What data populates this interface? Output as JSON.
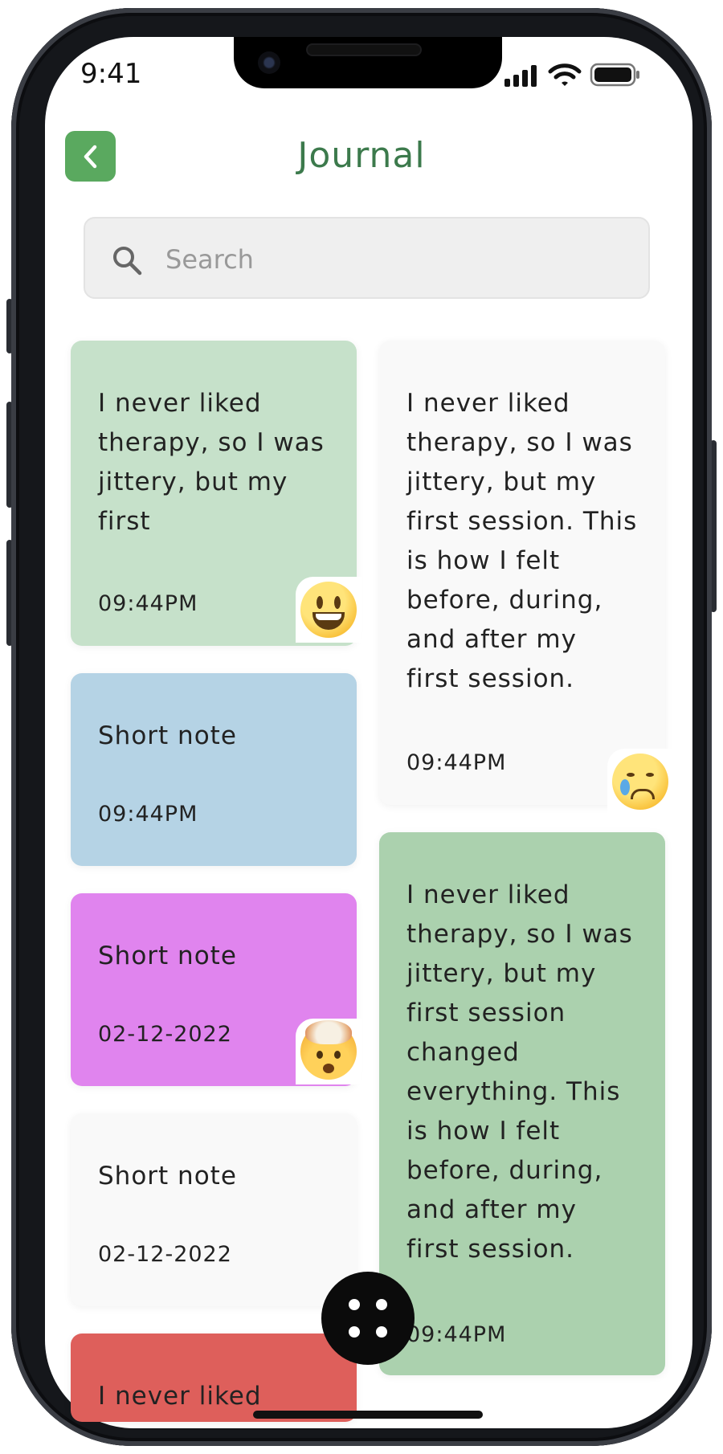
{
  "status_bar": {
    "time": "9:41"
  },
  "header": {
    "title": "Journal"
  },
  "search": {
    "placeholder": "Search"
  },
  "colors": {
    "green_light": "#c6e1ca",
    "blue": "#b5d3e5",
    "purple": "#e084ee",
    "white": "#f9f9f9",
    "red": "#de5f5b",
    "green_mid": "#abd1ae",
    "accent": "#5aa95f"
  },
  "notes": [
    {
      "text": "I never liked therapy, so I was jittery, but my first",
      "time": "09:44PM",
      "emoji": "smiling-face-emoji"
    },
    {
      "text": "Short note",
      "time": "09:44PM"
    },
    {
      "text": "Short note",
      "time": "02-12-2022",
      "emoji": "exploding-head-emoji"
    },
    {
      "text": "Short note",
      "time": "02-12-2022"
    },
    {
      "text": "I never liked",
      "time": ""
    },
    {
      "text": "I never liked therapy, so I was jittery, but my first session. This is how I felt before, during, and after my first session.",
      "time": "09:44PM",
      "emoji": "crying-face-emoji"
    },
    {
      "text": "I never liked therapy, so I was jittery, but my first session changed everything. This is how I felt before, during, and after my first session.",
      "time": "09:44PM"
    }
  ]
}
